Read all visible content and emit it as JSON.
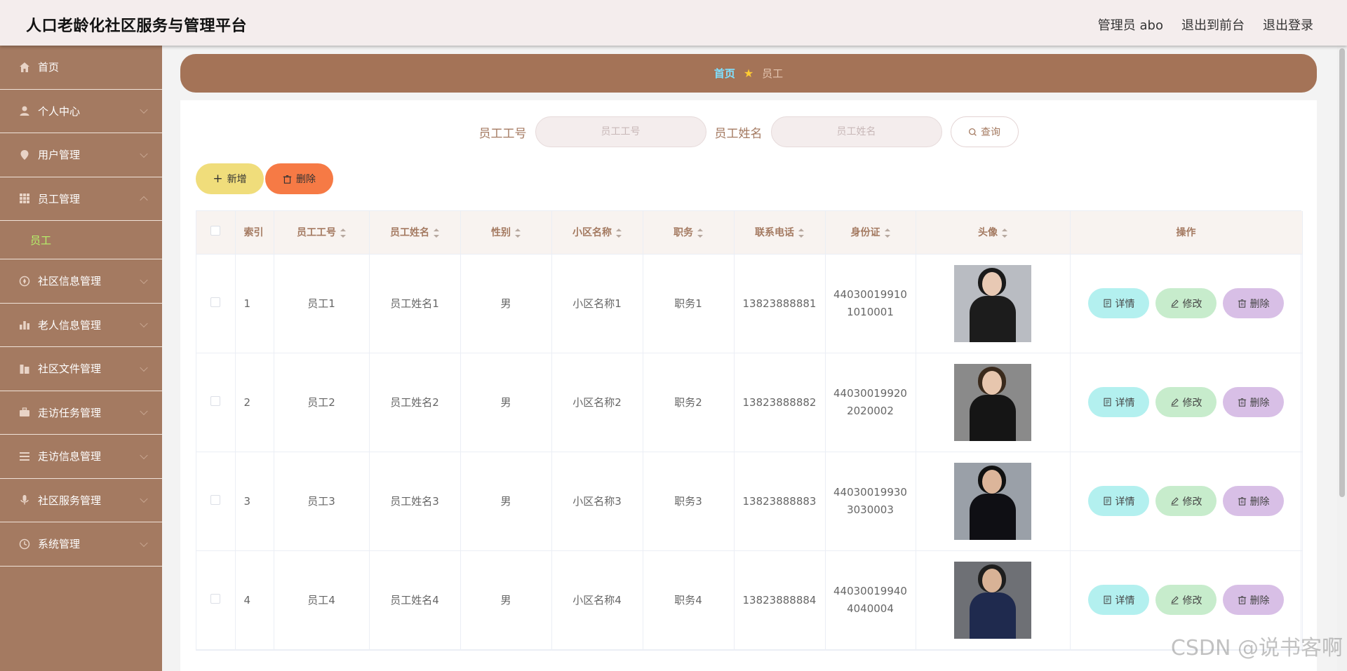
{
  "header": {
    "title": "人口老龄化社区服务与管理平台",
    "admin_label": "管理员 abo",
    "front_link": "退出到前台",
    "logout_link": "退出登录"
  },
  "sidebar": {
    "items": [
      {
        "label": "首页",
        "icon": "home-icon"
      },
      {
        "label": "个人中心",
        "icon": "user-icon"
      },
      {
        "label": "用户管理",
        "icon": "location-pin-icon"
      },
      {
        "label": "员工管理",
        "icon": "grid-icon",
        "expanded": true
      },
      {
        "label": "社区信息管理",
        "icon": "compass-icon"
      },
      {
        "label": "老人信息管理",
        "icon": "bar-chart-icon"
      },
      {
        "label": "社区文件管理",
        "icon": "building-icon"
      },
      {
        "label": "走访任务管理",
        "icon": "briefcase-icon"
      },
      {
        "label": "走访信息管理",
        "icon": "list-icon"
      },
      {
        "label": "社区服务管理",
        "icon": "microphone-icon"
      },
      {
        "label": "系统管理",
        "icon": "clock-icon"
      }
    ],
    "submenu": {
      "label": "员工"
    }
  },
  "breadcrumb": {
    "home": "首页",
    "current": "员工"
  },
  "search": {
    "field1_label": "员工工号",
    "field1_placeholder": "员工工号",
    "field2_label": "员工姓名",
    "field2_placeholder": "员工姓名",
    "button": "查询"
  },
  "toolbar": {
    "add_label": "新增",
    "delete_label": "删除"
  },
  "table": {
    "headers": [
      "索引",
      "员工工号",
      "员工姓名",
      "性别",
      "小区名称",
      "职务",
      "联系电话",
      "身份证",
      "头像",
      "操作"
    ],
    "rows": [
      {
        "index": "1",
        "emp_no": "员工1",
        "name": "员工姓名1",
        "gender": "男",
        "community": "小区名称1",
        "position": "职务1",
        "phone": "13823888881",
        "id_line1": "44030019910",
        "id_line2": "1010001"
      },
      {
        "index": "2",
        "emp_no": "员工2",
        "name": "员工姓名2",
        "gender": "男",
        "community": "小区名称2",
        "position": "职务2",
        "phone": "13823888882",
        "id_line1": "44030019920",
        "id_line2": "2020002"
      },
      {
        "index": "3",
        "emp_no": "员工3",
        "name": "员工姓名3",
        "gender": "男",
        "community": "小区名称3",
        "position": "职务3",
        "phone": "13823888883",
        "id_line1": "44030019930",
        "id_line2": "3030003"
      },
      {
        "index": "4",
        "emp_no": "员工4",
        "name": "员工姓名4",
        "gender": "男",
        "community": "小区名称4",
        "position": "职务4",
        "phone": "13823888884",
        "id_line1": "44030019940",
        "id_line2": "4040004"
      }
    ],
    "row_actions": {
      "detail": "详情",
      "edit": "修改",
      "remove": "删除"
    }
  },
  "watermark": "CSDN @说书客啊",
  "colors": {
    "sidebar": "#a47a61",
    "breadcrumb_bar": "#a47357",
    "accent_text": "#a47a61",
    "add_button": "#f0dd7b",
    "delete_button": "#f67a45",
    "detail_button": "#b3f0ef",
    "edit_button": "#c7eccc",
    "remove_button": "#d8bfe6"
  }
}
